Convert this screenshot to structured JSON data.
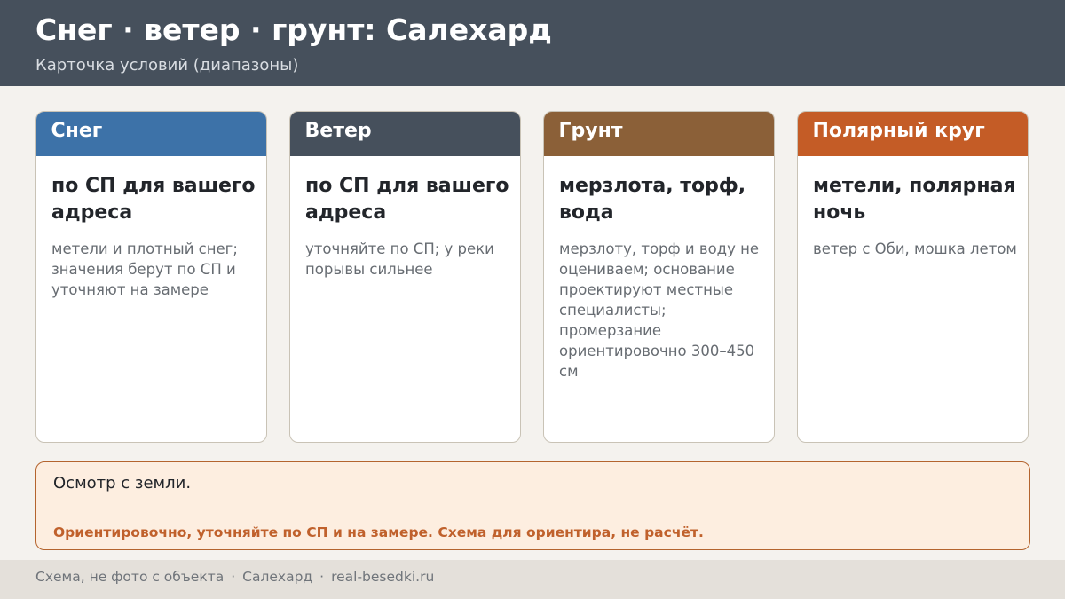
{
  "header": {
    "title": "Снег · ветер · грунт: Салехард",
    "subtitle": "Карточка условий (диапазоны)"
  },
  "cards": [
    {
      "heading": "Снег",
      "value": "по СП для вашего адреса",
      "note": "метели и плотный снег; значения берут по СП и уточняют на замере",
      "color": "#3d72a8"
    },
    {
      "heading": "Ветер",
      "value": "по СП для вашего адреса",
      "note": "уточняйте по СП; у реки порывы сильнее",
      "color": "#46505c"
    },
    {
      "heading": "Грунт",
      "value": "мерзлота, торф, вода",
      "note": "мерзлоту, торф и воду не оцениваем; основание проектируют местные специалисты; промерзание ориентировочно 300–450 см",
      "color": "#8b6038"
    },
    {
      "heading": "Полярный круг",
      "value": "метели, полярная ночь",
      "note": "ветер с Оби, мошка летом",
      "color": "#c45c26"
    }
  ],
  "notice": {
    "main": "Осмотр с земли.",
    "warning": "Ориентировочно, уточняйте по СП и на замере. Схема для ориентира, не расчёт."
  },
  "footer": {
    "items": [
      "Схема, не фото с объекта",
      "Салехард",
      "real-besedki.ru"
    ],
    "separator": "·"
  },
  "colors": {
    "header_bg": "#46505c",
    "page_bg": "#f4f2ee",
    "notice_bg": "#fdeee0",
    "notice_border": "#b4642e",
    "warning_text": "#c0612c",
    "footer_bg": "#e4e0da"
  }
}
